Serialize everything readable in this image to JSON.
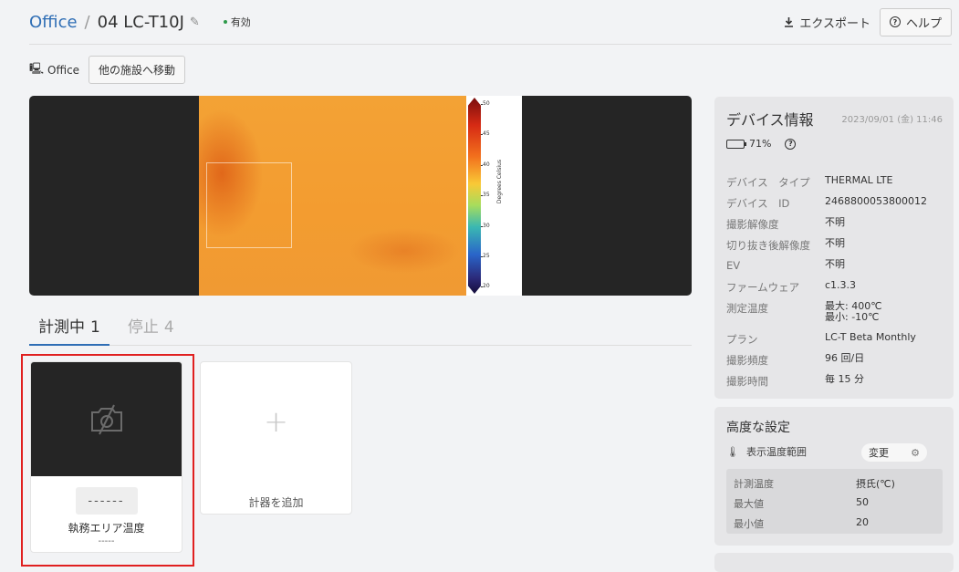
{
  "header": {
    "breadcrumb_root": "Office",
    "breadcrumb_sep": "/",
    "device_name": "04 LC-T10J",
    "status": "有効",
    "export_label": "エクスポート",
    "help_label": "ヘルプ"
  },
  "facility": {
    "name": "Office",
    "move_button": "他の施設へ移動"
  },
  "colorbar": {
    "label": "Degrees Celsius",
    "ticks": [
      "50",
      "45",
      "40",
      "35",
      "30",
      "25",
      "20"
    ]
  },
  "tabs": [
    {
      "label": "計測中",
      "count": "1"
    },
    {
      "label": "停止",
      "count": "4"
    }
  ],
  "meter_card": {
    "value": "------",
    "title": "執務エリア温度",
    "subtitle": "-----"
  },
  "add_card": {
    "plus": "+",
    "label": "計器を追加"
  },
  "device_info": {
    "title": "デバイス情報",
    "datetime": "2023/09/01 (金) 11:46",
    "battery": "71%",
    "battery_level": 0.71,
    "rows": [
      {
        "k": "デバイス　タイプ",
        "v": "THERMAL LTE"
      },
      {
        "k": "デバイス　ID",
        "v": "2468800053800012"
      },
      {
        "k": "撮影解像度",
        "v": "不明"
      },
      {
        "k": "切り抜き後解像度",
        "v": "不明"
      },
      {
        "k": "EV",
        "v": "不明"
      },
      {
        "k": "ファームウェア",
        "v": "c1.3.3"
      },
      {
        "k": "測定温度",
        "v": "最大: 400℃",
        "v2": "最小: -10℃"
      },
      {
        "k": "プラン",
        "v": "LC-T Beta Monthly"
      },
      {
        "k": "撮影頻度",
        "v": "96 回/日"
      },
      {
        "k": "撮影時間",
        "v": "毎 15 分"
      }
    ]
  },
  "advanced": {
    "title": "高度な設定",
    "range_label": "表示温度範囲",
    "change_button": "変更",
    "rows": [
      {
        "k": "計測温度",
        "v": "摂氏(℃)"
      },
      {
        "k": "最大値",
        "v": "50"
      },
      {
        "k": "最小値",
        "v": "20"
      }
    ]
  }
}
